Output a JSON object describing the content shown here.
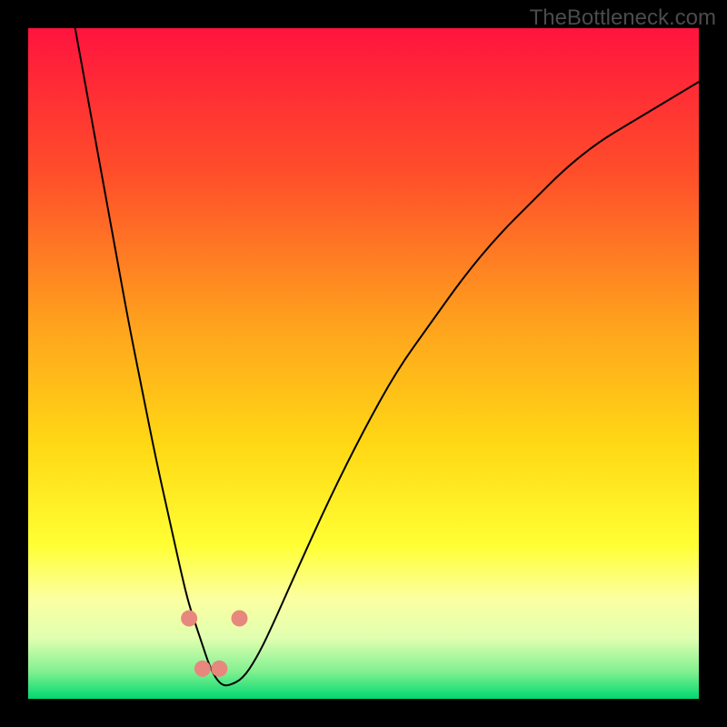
{
  "watermark": "TheBottleneck.com",
  "chart_data": {
    "type": "line",
    "title": "",
    "xlabel": "",
    "ylabel": "",
    "xlim": [
      0,
      100
    ],
    "ylim": [
      0,
      100
    ],
    "grid": false,
    "legend": false,
    "gradient_stops": [
      {
        "offset": 0.0,
        "color": "#ff143e"
      },
      {
        "offset": 0.22,
        "color": "#ff4f2a"
      },
      {
        "offset": 0.45,
        "color": "#ffa51d"
      },
      {
        "offset": 0.62,
        "color": "#ffd814"
      },
      {
        "offset": 0.77,
        "color": "#ffff33"
      },
      {
        "offset": 0.85,
        "color": "#fcffa0"
      },
      {
        "offset": 0.91,
        "color": "#e0ffb0"
      },
      {
        "offset": 0.96,
        "color": "#80f090"
      },
      {
        "offset": 1.0,
        "color": "#00d870"
      }
    ],
    "series": [
      {
        "name": "curve",
        "color": "#000000",
        "x": [
          7,
          9,
          11,
          13,
          15,
          17,
          19,
          21,
          23,
          24,
          25,
          26,
          27,
          28,
          29,
          30,
          32,
          34,
          36,
          40,
          45,
          50,
          55,
          60,
          65,
          70,
          75,
          80,
          85,
          90,
          95,
          100
        ],
        "y": [
          100,
          89,
          78,
          67,
          56,
          46,
          36,
          27,
          18,
          14,
          11,
          8,
          5,
          3,
          2,
          2,
          3,
          6,
          10,
          19,
          30,
          40,
          49,
          56,
          63,
          69,
          74,
          79,
          83,
          86,
          89,
          92
        ]
      }
    ],
    "curve_vertex_x": 28,
    "markers": [
      {
        "x": 24.0,
        "y": 12.0
      },
      {
        "x": 26.0,
        "y": 4.5
      },
      {
        "x": 28.5,
        "y": 4.5
      },
      {
        "x": 31.5,
        "y": 12.0
      }
    ],
    "marker_style": {
      "color": "#e8877d",
      "radius_px": 9
    }
  }
}
